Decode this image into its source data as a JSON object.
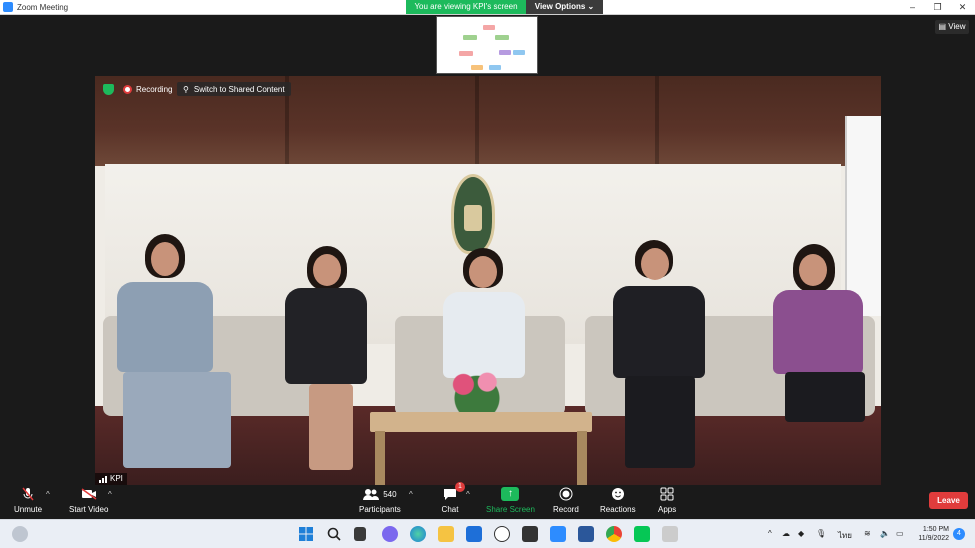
{
  "window": {
    "title": "Zoom Meeting",
    "controls": {
      "minimize": "–",
      "restore": "❐",
      "close": "✕"
    }
  },
  "banner": {
    "viewing_text": "You are viewing KPI's screen",
    "view_options_label": "View Options ⌄"
  },
  "view_button": {
    "label": "View"
  },
  "video_overlay": {
    "recording_label": "Recording",
    "switch_label": "Switch to Shared Content",
    "participant_name": "KPI"
  },
  "toolbar": {
    "unmute": "Unmute",
    "start_video": "Start Video",
    "participants": "Participants",
    "participants_count": "540",
    "chat": "Chat",
    "chat_badge": "1",
    "share_screen": "Share Screen",
    "record": "Record",
    "reactions": "Reactions",
    "apps": "Apps",
    "leave": "Leave",
    "caret": "^",
    "share_arrow": "↑"
  },
  "taskbar": {
    "language": "ไทย",
    "time": "1:50 PM",
    "date": "11/9/2022",
    "notifications": "4",
    "tray_caret": "^"
  },
  "colors": {
    "accent_green": "#1dba5c",
    "leave_red": "#e03c3c",
    "zoom_blue": "#2d8cff",
    "toolbar_bg": "#1a1a1a"
  }
}
